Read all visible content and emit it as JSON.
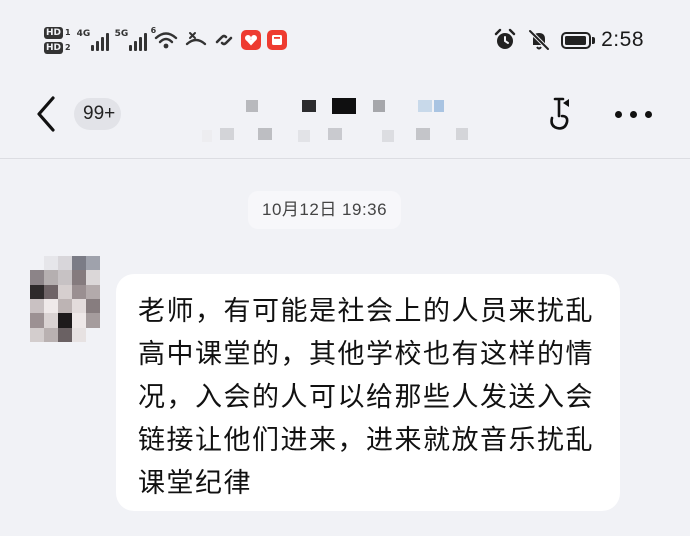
{
  "status_bar": {
    "network_1": "4G",
    "network_2": "5G",
    "hd_1": "HD",
    "hd_1_sub": "1",
    "hd_2": "HD",
    "hd_2_sub": "2",
    "wifi_level": "6",
    "icons_left": [
      "hd-icon",
      "signal-4g-icon",
      "signal-5g-icon",
      "wifi-icon",
      "missed-call-icon",
      "link-icon",
      "app-notification-icon",
      "message-notification-icon"
    ],
    "icons_right": [
      "alarm-icon",
      "mute-icon",
      "battery-icon"
    ],
    "battery_level": 0.95,
    "time": "2:58"
  },
  "header": {
    "unread_count": "99+",
    "chat_title_obscured": true,
    "icons": [
      "back-chevron-icon",
      "pin-icon",
      "more-icon"
    ]
  },
  "messages": [
    {
      "timestamp": "10月12日 19:36"
    },
    {
      "sender_avatar_obscured": true,
      "text": "老师，有可能是社会上的人员来扰乱高中课堂的，其他学校也有这样的情况，入会的人可以给那些人发送入会链接让他们进来，进来就放音乐扰乱课堂纪律"
    }
  ],
  "colors": {
    "background": "#f1f2f6",
    "bubble": "#ffffff",
    "text": "#111111",
    "notification_red": "#ee3b30"
  }
}
